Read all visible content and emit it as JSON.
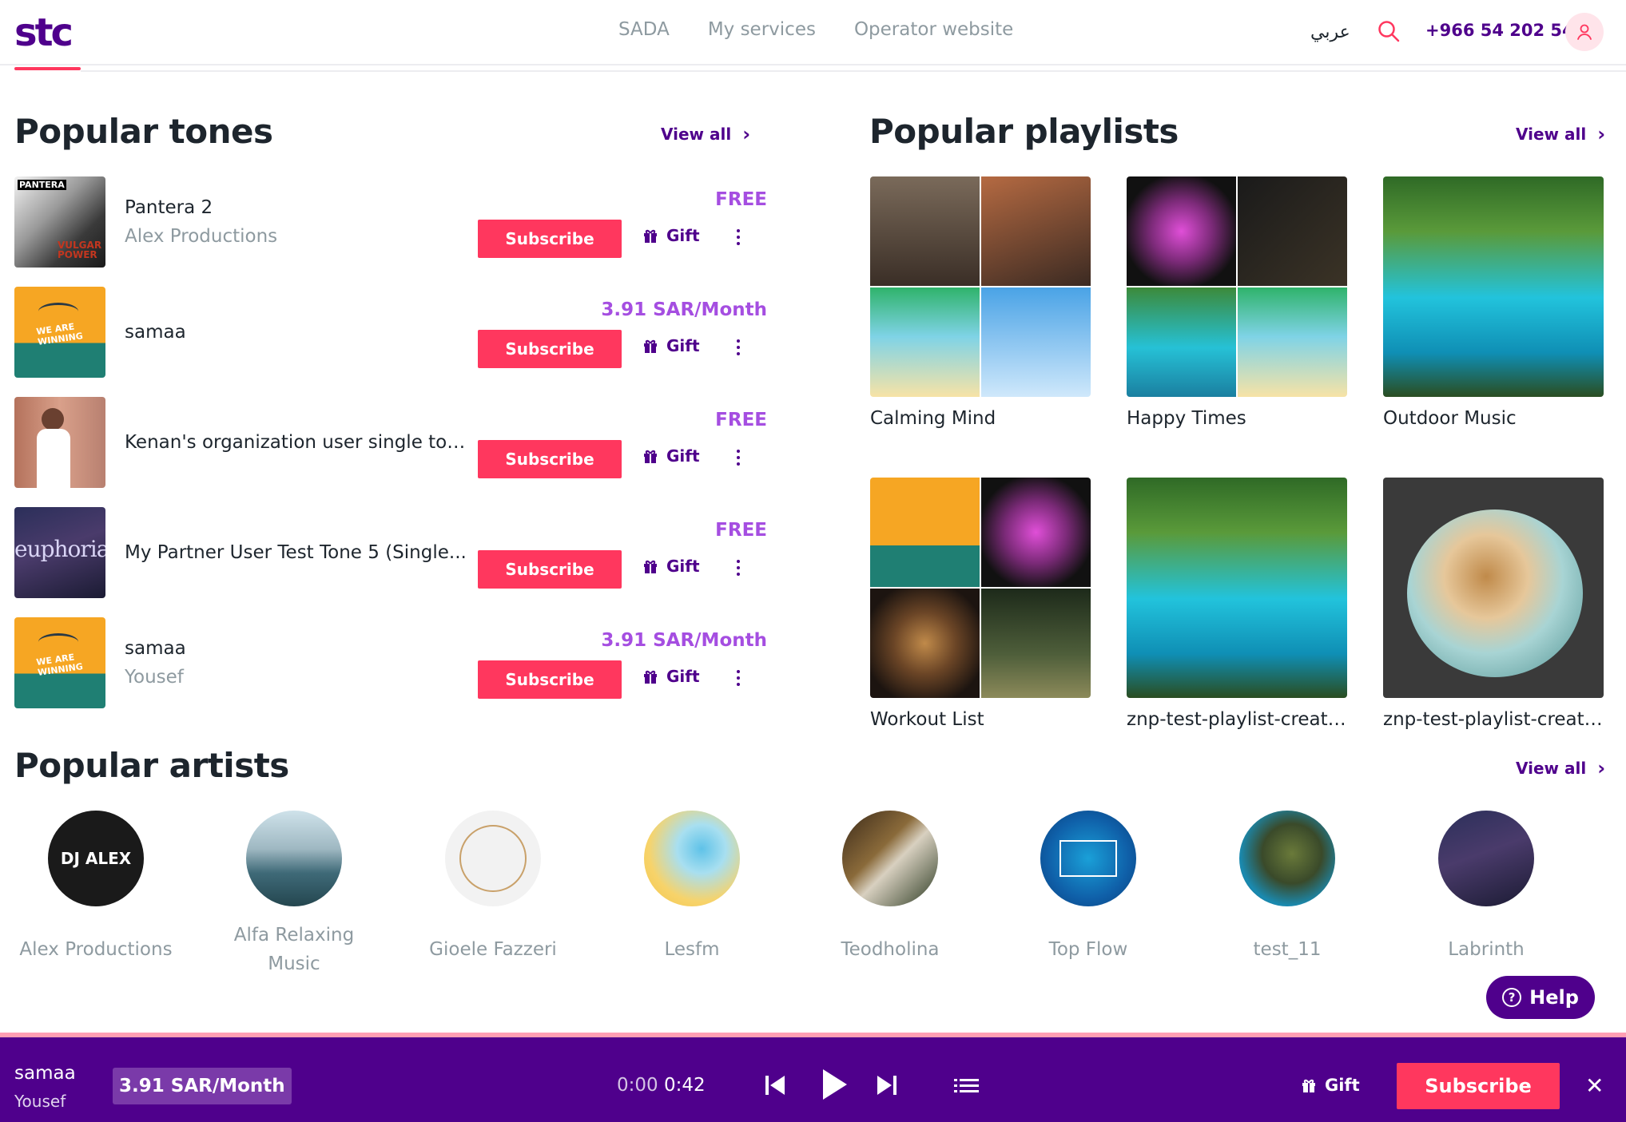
{
  "header": {
    "logo": "stc",
    "nav": [
      "SADA",
      "My services",
      "Operator website"
    ],
    "language": "عربي",
    "phone": "+966 54 202 5430"
  },
  "tones": {
    "title": "Popular tones",
    "view_all": "View all",
    "subscribe_label": "Subscribe",
    "gift_label": "Gift",
    "items": [
      {
        "name": "Pantera 2",
        "artist": "Alex Productions",
        "price": "FREE"
      },
      {
        "name": "samaa",
        "artist": "",
        "price": "3.91 SAR/Month"
      },
      {
        "name": "Kenan's organization user single tone...",
        "artist": "",
        "price": "FREE"
      },
      {
        "name": "My Partner User Test Tone 5 (Single...",
        "artist": "",
        "price": "FREE"
      },
      {
        "name": "samaa",
        "artist": "Yousef",
        "price": "3.91 SAR/Month"
      }
    ]
  },
  "playlists": {
    "title": "Popular playlists",
    "view_all": "View all",
    "items": [
      {
        "name": "Calming Mind"
      },
      {
        "name": "Happy Times"
      },
      {
        "name": "Outdoor Music"
      },
      {
        "name": "Workout List"
      },
      {
        "name": "znp-test-playlist-create..."
      },
      {
        "name": "znp-test-playlist-create..."
      }
    ]
  },
  "artists": {
    "title": "Popular artists",
    "view_all": "View all",
    "items": [
      {
        "name": "Alex Productions"
      },
      {
        "name": "Alfa Relaxing Music"
      },
      {
        "name": "Gioele Fazzeri"
      },
      {
        "name": "Lesfm"
      },
      {
        "name": "Teodholina"
      },
      {
        "name": "Top Flow"
      },
      {
        "name": "test_11"
      },
      {
        "name": "Labrinth"
      }
    ]
  },
  "help": {
    "label": "Help"
  },
  "player": {
    "title": "samaa",
    "artist": "Yousef",
    "price": "3.91 SAR/Month",
    "time_current": "0:00",
    "time_total": "0:42",
    "gift_label": "Gift",
    "subscribe_label": "Subscribe"
  },
  "colors": {
    "brand": "#4f008c",
    "accent": "#ff375e",
    "price": "#a54ee1"
  }
}
